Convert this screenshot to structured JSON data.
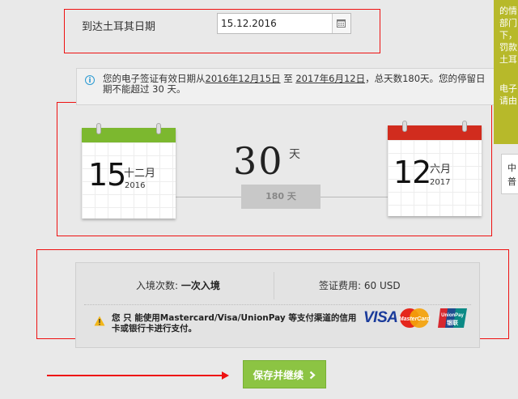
{
  "arrival": {
    "label": "到达土耳其日期",
    "value": "15.12.2016"
  },
  "info": {
    "text_pre": "您的电子签证有效日期从",
    "start": "2016年12月15日",
    "text_mid": " 至 ",
    "end": "2017年6月12日",
    "text_post": "，总天数180天。您的停留日期不能超过 30 天。"
  },
  "start_cal": {
    "day": "15",
    "month": "十二月",
    "year": "2016",
    "color": "#7cb82f"
  },
  "end_cal": {
    "day": "12",
    "month": "六月",
    "year": "2017",
    "color": "#d12c1e"
  },
  "stay": {
    "days": "30",
    "unit": "天",
    "total": "180 天"
  },
  "summary": {
    "entries_label": "入境次数: ",
    "entries_value": "一次入境",
    "fee_label": "签证费用: ",
    "fee_value": "60 USD",
    "payment_notice": "您 只 能使用Mastercard/Visa/UnionPay 等支付渠道的信用卡或银行卡进行支付。",
    "visa_logo": "VISA",
    "mastercard_logo": "MasterCard",
    "unionpay_logo": "UnionPay",
    "unionpay_cn": "银联"
  },
  "save_button": {
    "label": "保存并继续",
    "icon": "chevron-right-icon"
  },
  "right_panel": {
    "yellow_lines": [
      "的情",
      "部门",
      "下，",
      "罚款",
      "土耳",
      "",
      "电子",
      "请由"
    ],
    "white_lines": [
      "中",
      "普"
    ]
  },
  "colors": {
    "accent": "#8cc443",
    "annotation": "#ee1111",
    "info_icon": "#2a9ad3"
  }
}
